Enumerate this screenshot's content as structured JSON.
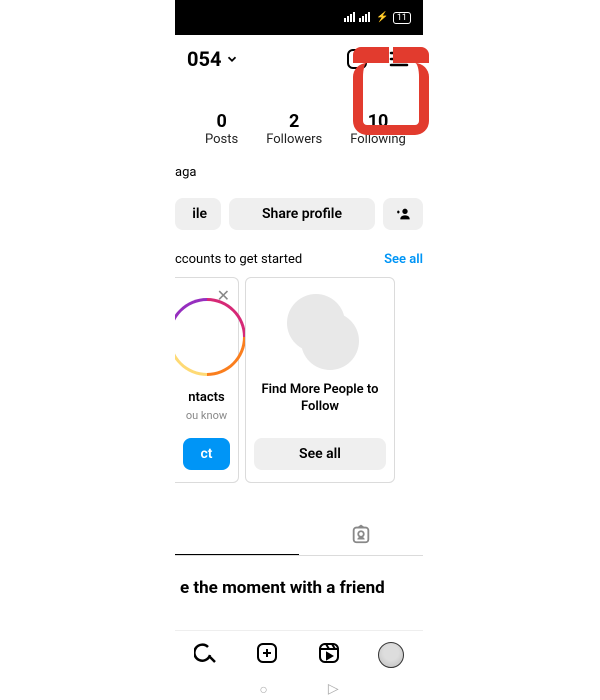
{
  "status": {
    "battery": "11"
  },
  "header": {
    "username_fragment": "054"
  },
  "stats": {
    "posts": {
      "count": "0",
      "label": "Posts"
    },
    "followers": {
      "count": "2",
      "label": "Followers"
    },
    "following": {
      "count": "10",
      "label": "Following"
    }
  },
  "profile": {
    "name_fragment": "aga"
  },
  "buttons": {
    "edit_fragment": "ile",
    "share": "Share profile"
  },
  "discover": {
    "heading_fragment": "ccounts to get started",
    "see_all": "See all"
  },
  "cards": {
    "contacts": {
      "title_fragment": "ntacts",
      "sub_fragment": "ou know",
      "btn_fragment": "ct"
    },
    "findmore": {
      "title": "Find More People to Follow",
      "btn": "See all"
    }
  },
  "moment": {
    "text_fragment": "e the moment with a friend"
  }
}
